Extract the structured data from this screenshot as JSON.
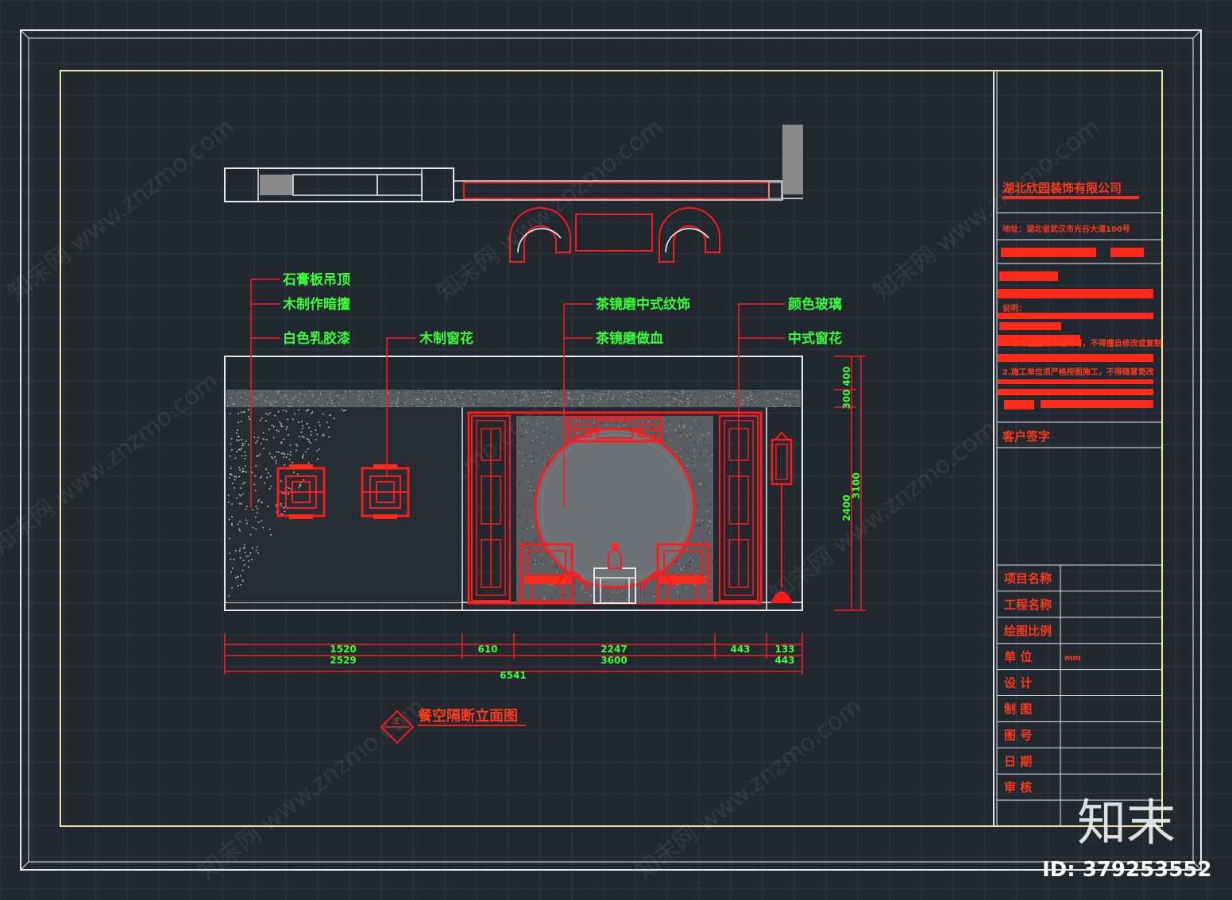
{
  "drawing": {
    "title": "餐空隔断立面图",
    "symbol_letter": "E"
  },
  "labels_left": [
    "石膏板吊顶",
    "木制作暗擅",
    "白色乳胶漆"
  ],
  "label_mid_left": "木制窗花",
  "labels_center": [
    "茶镜磨中式纹饰",
    "茶镜磨做血"
  ],
  "labels_right": [
    "颜色玻璃",
    "中式窗花"
  ],
  "dims_horizontal": {
    "segment_a": "1520",
    "segment_a2": "2529",
    "segment_b": "610",
    "segment_c": "2247",
    "segment_c2": "3600",
    "segment_d": "443",
    "segment_e": "133",
    "segment_e2": "443",
    "total": "6541"
  },
  "dims_vertical": {
    "top_a": "400",
    "top_b": "300",
    "height_main": "2400",
    "height_total": "3100"
  },
  "title_block": {
    "company": "湖北欣园装饰有限公司",
    "address": "地址：湖北省武汉市光谷大道100号",
    "notes_heading": "说明：",
    "note_1": "1.本工程图纸未经许可，不得擅自修改或复制",
    "note_2": "2.施工单位须严格按图施工，不得随意更改",
    "client_sign": "客户签字",
    "rows": [
      "项目名称",
      "工程名称",
      "绘图比例",
      "单 位",
      "设 计",
      "制 图",
      "图 号",
      "日 期",
      "审 核",
      "审 核"
    ],
    "unit_value": "mm"
  },
  "watermark": {
    "text": "知末网 www.znzmo.com",
    "logo": "知末",
    "id": "ID: 379253552"
  },
  "colors": {
    "background": "#212830",
    "frame": "#e8e8e8",
    "inner_frame": "#f0e6a0",
    "red": "#ff1a1a",
    "label_green": "#39ff39",
    "title_block_red": "#ff3a1a"
  }
}
